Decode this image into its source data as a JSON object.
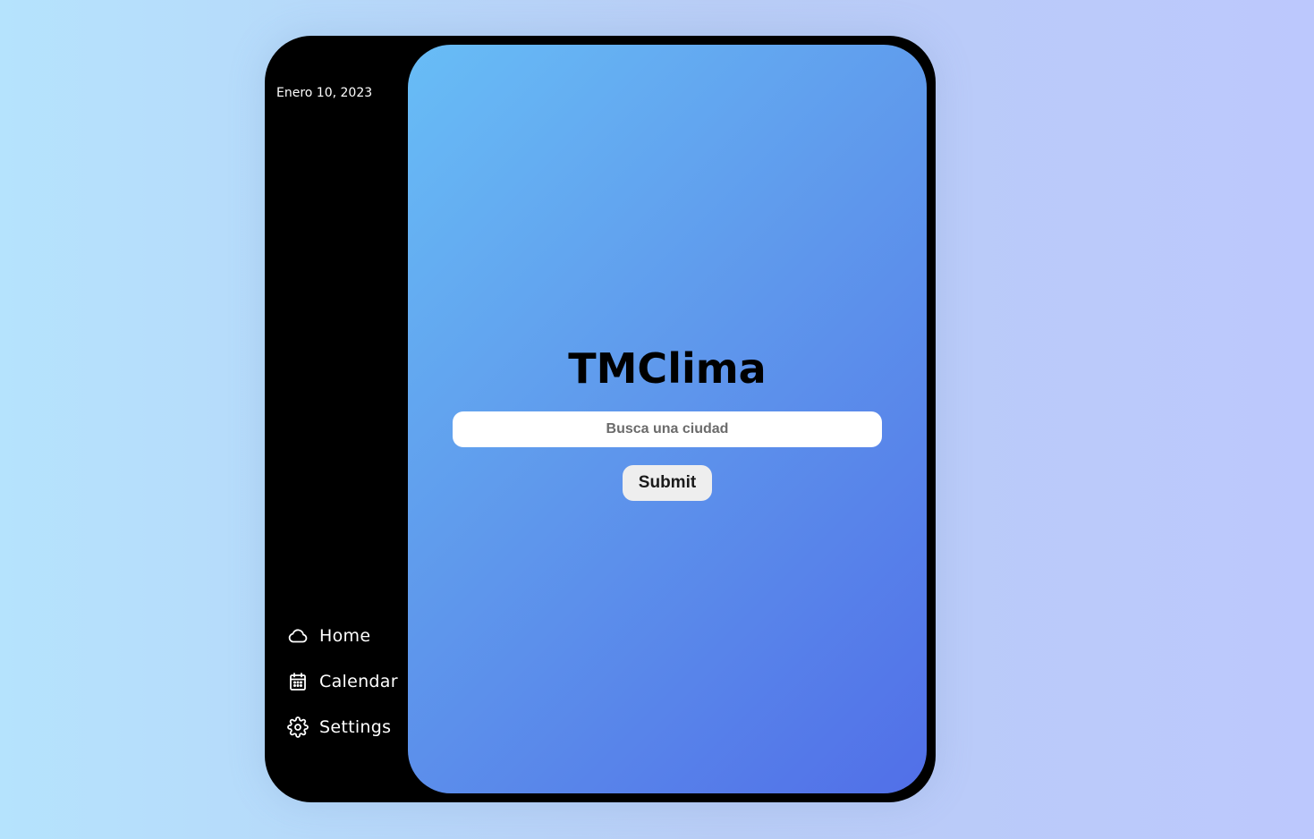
{
  "sidebar": {
    "date": "Enero 10, 2023",
    "items": [
      {
        "label": "Home",
        "icon": "cloud-icon"
      },
      {
        "label": "Calendar",
        "icon": "calendar-icon"
      },
      {
        "label": "Settings",
        "icon": "gear-icon"
      }
    ]
  },
  "main": {
    "title": "TMClima",
    "search": {
      "placeholder": "Busca una ciudad",
      "value": ""
    },
    "submit_label": "Submit"
  },
  "colors": {
    "page_background_start": "#b5e3fd",
    "page_background_end": "#bcc8fd",
    "frame": "#000000",
    "panel_gradient_start": "#68bdf6",
    "panel_gradient_end": "#516fe8",
    "submit_background": "#eeeeee"
  }
}
